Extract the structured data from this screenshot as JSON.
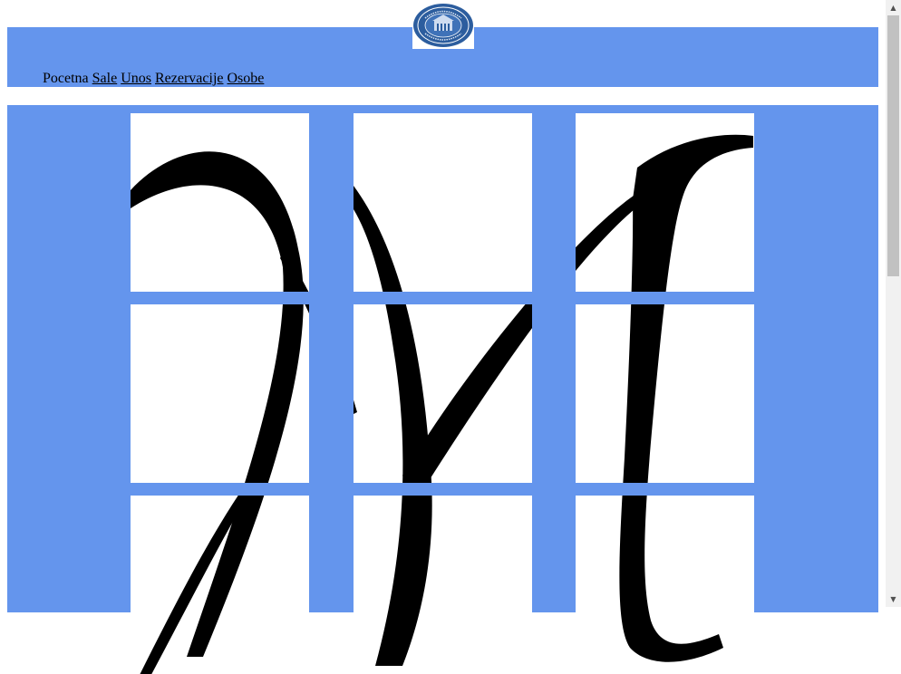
{
  "colors": {
    "brand_blue": "#6495ed",
    "tile_bg": "#ffffff",
    "ink": "#000000",
    "seal_blue": "#2c5d9e"
  },
  "logo": {
    "icon": "university-seal-icon"
  },
  "nav": {
    "home": "Pocetna",
    "links": [
      "Sale",
      "Unos",
      "Rezervacije",
      "Osobe"
    ]
  },
  "gallery": {
    "rows": 3,
    "cols": 3,
    "image": "letter-M-calligraphy"
  }
}
